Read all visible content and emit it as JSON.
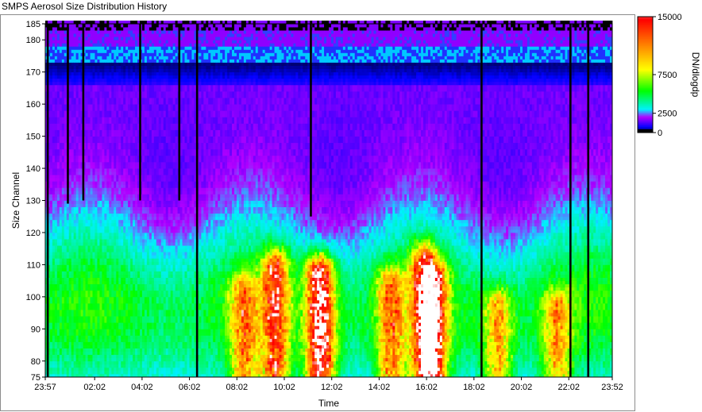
{
  "window": {
    "title": "SMPS Aerosol Size Distribution History"
  },
  "chart_data": {
    "type": "heatmap",
    "title": "SMPS Aerosol Size Distribution History",
    "xlabel": "Time",
    "ylabel": "Size Channel",
    "x_tick_labels": [
      "23:57",
      "02:02",
      "04:02",
      "06:02",
      "08:02",
      "10:02",
      "12:02",
      "14:02",
      "16:02",
      "18:02",
      "20:02",
      "22:02",
      "23:52"
    ],
    "x_tick_positions_hours": [
      -0.05,
      2.033,
      4.033,
      6.033,
      8.033,
      10.033,
      12.033,
      14.033,
      16.033,
      18.033,
      20.033,
      22.033,
      23.867
    ],
    "xlim_hours": [
      -0.05,
      23.867
    ],
    "y_tick_labels": [
      "75",
      "80",
      "90",
      "100",
      "110",
      "120",
      "130",
      "140",
      "150",
      "160",
      "170",
      "180",
      "185"
    ],
    "y_ticks": [
      75,
      80,
      90,
      100,
      110,
      120,
      130,
      140,
      150,
      160,
      170,
      180,
      185
    ],
    "ylim": [
      75,
      185
    ],
    "colorbar": {
      "label": "DN/dlogdp",
      "tick_labels": [
        "15000",
        "7500",
        "2500",
        "0"
      ],
      "ticks": [
        15000,
        7500,
        2500,
        0
      ],
      "range": [
        0,
        15000
      ]
    },
    "colormap": [
      "#000000",
      "#0000ff",
      "#00ffff",
      "#00ff00",
      "#ffff00",
      "#ff8000",
      "#ff0000",
      "#ffffff"
    ],
    "missing_scans": [
      {
        "time_h": 0.05,
        "from_channel": 75,
        "to_channel": 185
      },
      {
        "time_h": 0.9,
        "from_channel": 129,
        "to_channel": 185
      },
      {
        "time_h": 1.55,
        "from_channel": 130,
        "to_channel": 185
      },
      {
        "time_h": 3.95,
        "from_channel": 130,
        "to_channel": 185
      },
      {
        "time_h": 5.6,
        "from_channel": 130,
        "to_channel": 185
      },
      {
        "time_h": 6.35,
        "from_channel": 75,
        "to_channel": 185
      },
      {
        "time_h": 11.15,
        "from_channel": 125,
        "to_channel": 185
      },
      {
        "time_h": 18.35,
        "from_channel": 75,
        "to_channel": 185
      },
      {
        "time_h": 22.1,
        "from_channel": 75,
        "to_channel": 185
      },
      {
        "time_h": 22.85,
        "from_channel": 75,
        "to_channel": 185
      }
    ],
    "concentration_events": [
      {
        "center_h": 8.3,
        "peak": 9000,
        "top_channel": 100
      },
      {
        "center_h": 9.6,
        "peak": 12000,
        "top_channel": 108
      },
      {
        "center_h": 11.5,
        "peak": 17000,
        "top_channel": 106
      },
      {
        "center_h": 14.5,
        "peak": 9500,
        "top_channel": 103
      },
      {
        "center_h": 15.9,
        "peak": 12000,
        "top_channel": 110
      },
      {
        "center_h": 16.3,
        "peak": 12500,
        "top_channel": 104
      },
      {
        "center_h": 19.0,
        "peak": 8000,
        "top_channel": 96
      },
      {
        "center_h": 21.5,
        "peak": 7500,
        "top_channel": 96
      }
    ]
  }
}
